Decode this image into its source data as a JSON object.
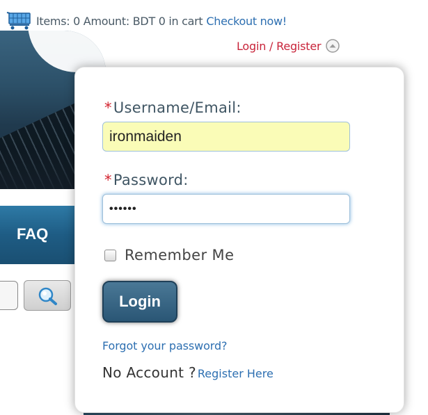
{
  "cart": {
    "items_label": "Items: 0 Amount: BDT  0 in cart",
    "checkout_label": "Checkout now!"
  },
  "header": {
    "login_register_label": "Login / Register"
  },
  "background": {
    "nav_faq_label": "FAQ"
  },
  "login_form": {
    "username_label": "Username/Email:",
    "username_value": "ironmaiden",
    "password_label": "Password:",
    "password_value": "••••••",
    "required_marker": "*",
    "remember_label": "Remember Me",
    "remember_checked": false,
    "login_button_label": "Login",
    "forgot_link": "Forgot your password?",
    "no_account_text": "No Account ?",
    "register_link": "Register Here"
  },
  "colors": {
    "required": "#d3232f",
    "link": "#2d6fb1",
    "login_toggle": "#c8243a",
    "button": "#2a5675",
    "autofill": "#fafcb7"
  },
  "icons": {
    "cart": "cart-icon",
    "collapse": "chevron-up-circle-icon",
    "search": "magnifier-icon"
  }
}
